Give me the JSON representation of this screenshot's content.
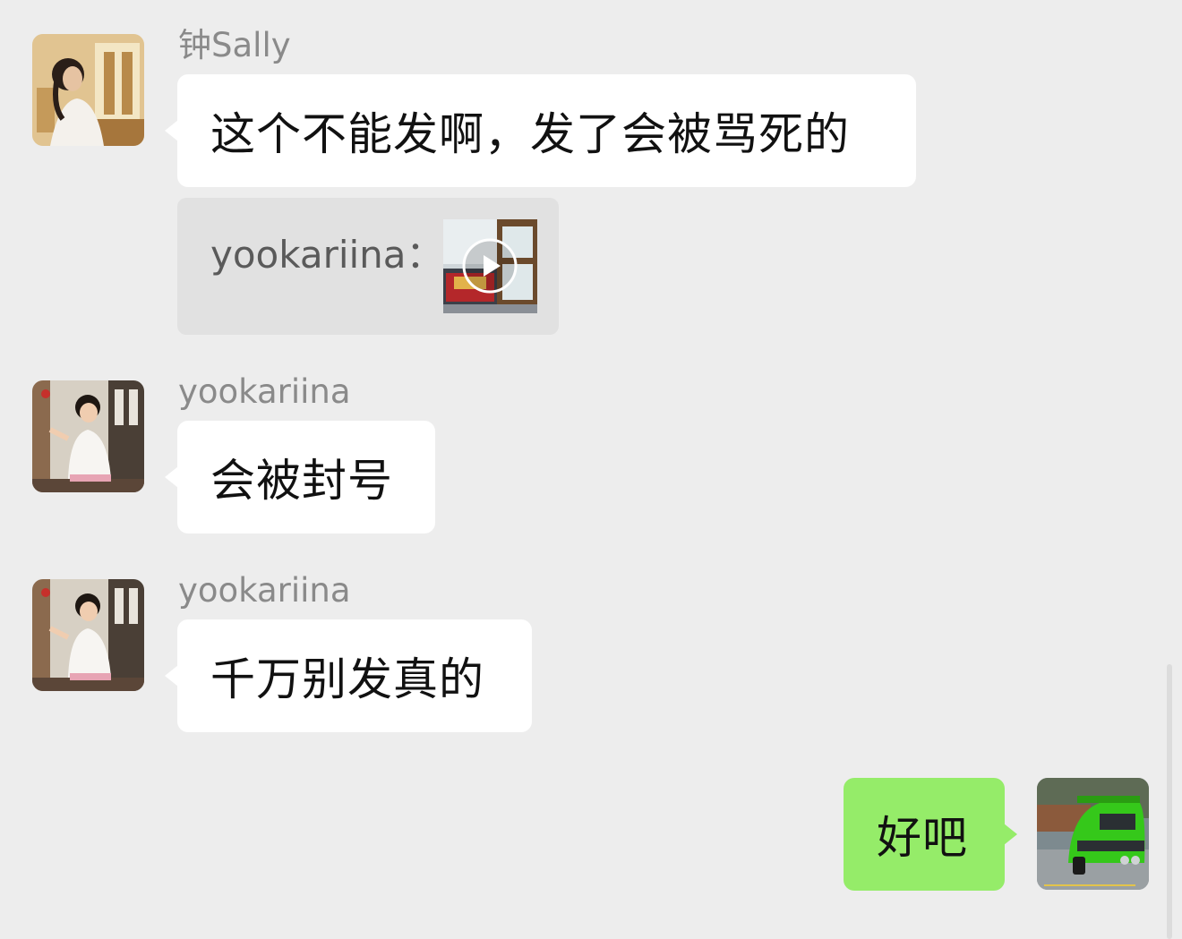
{
  "messages": [
    {
      "sender": "钟Sally",
      "text": "这个不能发啊，发了会被骂死的",
      "avatar_icon": "woman-portrait-avatar"
    },
    {
      "quote": {
        "author": "yookariina：",
        "attachment_icon": "video-play-thumbnail"
      }
    },
    {
      "sender": "yookariina",
      "text": "会被封号",
      "avatar_icon": "girl-portrait-avatar"
    },
    {
      "sender": "yookariina",
      "text": "千万别发真的",
      "avatar_icon": "girl-portrait-avatar"
    },
    {
      "text": "好吧",
      "avatar_icon": "green-car-avatar",
      "outgoing": true
    }
  ],
  "colors": {
    "background": "#ededed",
    "incoming_bubble": "#ffffff",
    "outgoing_bubble": "#95ec69",
    "quote_bg": "#e1e1e1",
    "sender_name": "#8a8a8a"
  }
}
